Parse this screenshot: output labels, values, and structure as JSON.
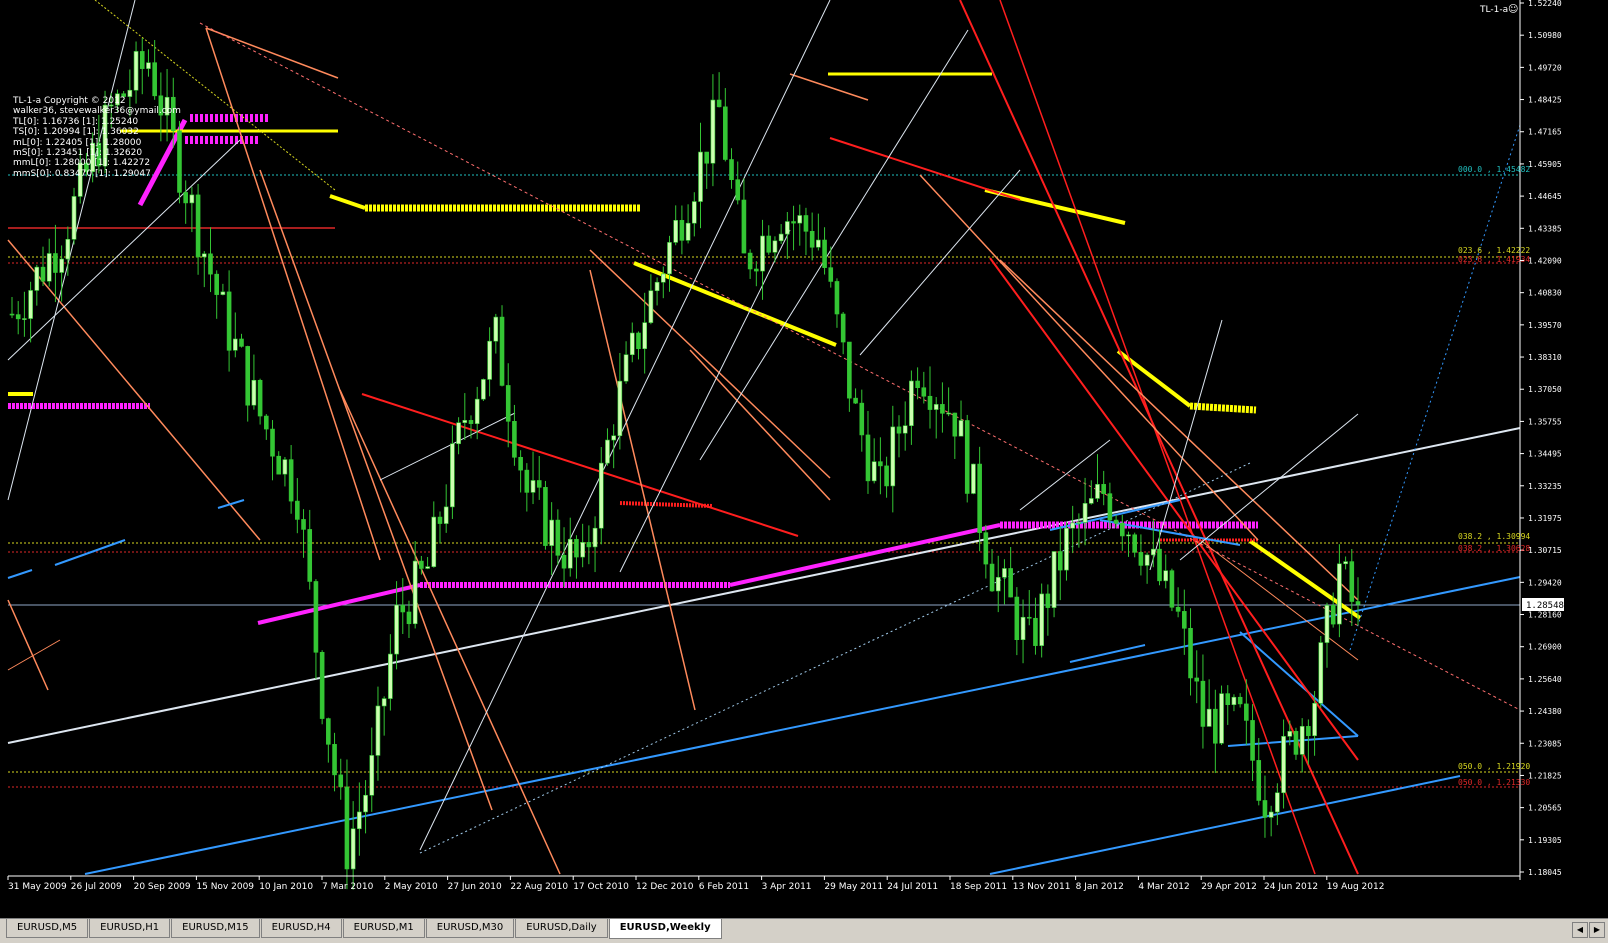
{
  "indicator": {
    "name": "TL-1-a",
    "smiley": "☺",
    "lines": [
      "TL-1-a Copyright © 2012",
      "walker36, stevewalker36@ymail.com",
      "TL[0]: 1.16736   [1]: 1.25240",
      "TS[0]: 1.20994   [1]: 1.36032",
      "mL[0]: 1.22405   [1]: 1.28000",
      "mS[0]: 1.23451   [1]: 1.32620",
      "mmL[0]: 1.28000  [1]: 1.42272",
      "mmS[0]: 0.83470  [1]: 1.29047"
    ]
  },
  "price_axis": {
    "ticks": [
      "1.52240",
      "1.50980",
      "1.49720",
      "1.48425",
      "1.47165",
      "1.45905",
      "1.44645",
      "1.43385",
      "1.42090",
      "1.40830",
      "1.39570",
      "1.38310",
      "1.37050",
      "1.35755",
      "1.34495",
      "1.33235",
      "1.31975",
      "1.30715",
      "1.29420",
      "1.28160",
      "1.26900",
      "1.25640",
      "1.24380",
      "1.23085",
      "1.21825",
      "1.20565",
      "1.19305",
      "1.18045"
    ],
    "current_price": "1.28548"
  },
  "time_axis": {
    "labels": [
      "31 May 2009",
      "26 Jul 2009",
      "20 Sep 2009",
      "15 Nov 2009",
      "10 Jan 2010",
      "7 Mar 2010",
      "2 May 2010",
      "27 Jun 2010",
      "22 Aug 2010",
      "17 Oct 2010",
      "12 Dec 2010",
      "6 Feb 2011",
      "3 Apr 2011",
      "29 May 2011",
      "24 Jul 2011",
      "18 Sep 2011",
      "13 Nov 2011",
      "8 Jan 2012",
      "4 Mar 2012",
      "29 Apr 2012",
      "24 Jun 2012",
      "19 Aug 2012"
    ]
  },
  "fib_labels": {
    "l0": "000.0 , 1.45482",
    "l236y": "023.6 , 1.42222",
    "l236r": "023.6 , 1.41934",
    "l382y": "038.2 , 1.30994",
    "l382r": "038.2 , 1.30628",
    "l50y": "050.0 , 1.21920",
    "l50r": "050.0 , 1.21330"
  },
  "tabs": [
    {
      "label": "EURUSD,M5",
      "active": false
    },
    {
      "label": "EURUSD,H1",
      "active": false
    },
    {
      "label": "EURUSD,M15",
      "active": false
    },
    {
      "label": "EURUSD,H4",
      "active": false
    },
    {
      "label": "EURUSD,M1",
      "active": false
    },
    {
      "label": "EURUSD,M30",
      "active": false
    },
    {
      "label": "EURUSD,Daily",
      "active": false
    },
    {
      "label": "EURUSD,Weekly",
      "active": true
    }
  ],
  "colors": {
    "background": "#000000",
    "bull_candle": "#ccffb0",
    "bear_candle": "#34c634",
    "axis_text": "#ffffff",
    "blue_trend": "#3399ff",
    "white_trend": "#dde6f0",
    "red_trend": "#ff1e1e",
    "orange_trend": "#ff8a5c",
    "yellow_trend": "#ffff00",
    "magenta_trend": "#ff22ff",
    "fib_yellow": "#d8d820",
    "fib_red": "#e02828",
    "fib_cyan": "#20c0c0"
  },
  "chart_data": {
    "type": "candlestick",
    "symbol": "EURUSD",
    "timeframe": "Weekly",
    "ylim": [
      1.18045,
      1.5224
    ],
    "current_price": 1.28548,
    "x_start": "31 May 2009",
    "x_end": "19 Aug 2012",
    "close_path": [
      [
        0,
        1.4
      ],
      [
        8,
        1.43
      ],
      [
        16,
        1.48
      ],
      [
        22,
        1.5
      ],
      [
        28,
        1.45
      ],
      [
        34,
        1.4
      ],
      [
        40,
        1.36
      ],
      [
        46,
        1.33
      ],
      [
        50,
        1.25
      ],
      [
        54,
        1.19
      ],
      [
        58,
        1.22
      ],
      [
        62,
        1.28
      ],
      [
        67,
        1.3
      ],
      [
        73,
        1.36
      ],
      [
        78,
        1.39
      ],
      [
        83,
        1.33
      ],
      [
        88,
        1.31
      ],
      [
        92,
        1.3
      ],
      [
        97,
        1.36
      ],
      [
        102,
        1.4
      ],
      [
        108,
        1.44
      ],
      [
        114,
        1.48
      ],
      [
        118,
        1.42
      ],
      [
        124,
        1.44
      ],
      [
        130,
        1.43
      ],
      [
        136,
        1.36
      ],
      [
        140,
        1.33
      ],
      [
        146,
        1.38
      ],
      [
        152,
        1.36
      ],
      [
        158,
        1.3
      ],
      [
        164,
        1.27
      ],
      [
        170,
        1.31
      ],
      [
        176,
        1.33
      ],
      [
        182,
        1.31
      ],
      [
        188,
        1.28
      ],
      [
        192,
        1.24
      ],
      [
        198,
        1.24
      ],
      [
        202,
        1.21
      ],
      [
        206,
        1.23
      ],
      [
        210,
        1.25
      ],
      [
        214,
        1.3
      ],
      [
        217,
        1.28
      ]
    ]
  }
}
